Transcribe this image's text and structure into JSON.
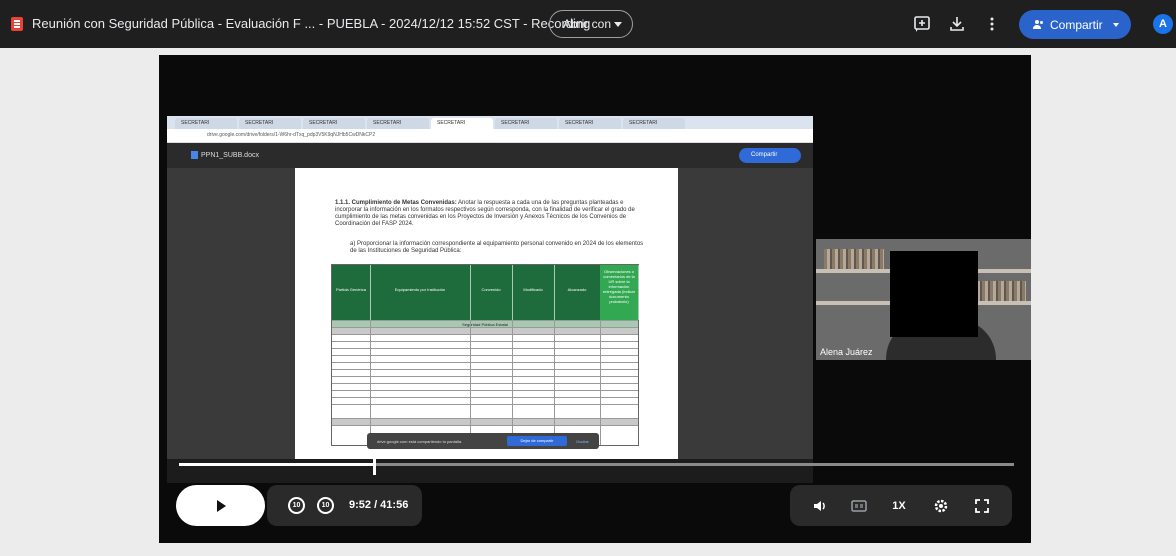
{
  "topbar": {
    "title": "Reunión con Seguridad Pública - Evaluación F ... - PUEBLA - 2024/12/12 15:52 CST - Recording",
    "open_with_label": "Abrir con",
    "share_label": "Compartir",
    "avatar_initial": "A",
    "icons": [
      "add-comment-icon",
      "download-icon",
      "more-vert-icon",
      "people-icon",
      "chevron-down-icon"
    ]
  },
  "video": {
    "screen": {
      "tabs": [
        "SECRETARI",
        "SECRETARI",
        "SECRETARI",
        "SECRETARI",
        "SECRETARI",
        "SECRETARI",
        "SECRETARI",
        "SECRETARI"
      ],
      "address": "drive.google.com/drive/folders/1-W6hr-dTxq_pdp3V5K9qNJHb5CwDNkCP2",
      "doc_name": "PPN1_SUBB.docx",
      "doc_share_label": "Compartir",
      "heading_bold": "1.1.1. Cumplimiento de Metas Convenidas:",
      "heading_text": " Anotar la respuesta a cada una de las preguntas planteadas e incorporar la información en los formatos respectivos según corresponda, con la finalidad de verificar el grado de cumplimiento de las metas convenidas en los Proyectos de Inversión y Anexos Técnicos de los Convenios de Coordinación del FASP 2024.",
      "item_text": "a) Proporcionar la información correspondiente al equipamiento personal convenido en 2024 de los elementos de las Instituciones de Seguridad Pública:",
      "table_headers": [
        "Partida Genérica",
        "Equipamiento por Institución",
        "Convenido",
        "Modificado",
        "Alcanzado",
        "Observaciones o comentarios de la UR sobre la información entregada (indicar documento probatorio)"
      ],
      "table_section": "Seguridad Pública Estatal",
      "toast_text": "drive.google.com está compartiendo tu pantalla.",
      "toast_stop": "Dejar de compartir",
      "toast_hide": "Ocultar"
    },
    "participant_name": "Alena Juárez",
    "progress_fraction": 0.234,
    "time_display": "9:52 / 41:56",
    "speed_label": "1X",
    "seek_back_label": "10",
    "seek_forward_label": "10",
    "controls": [
      "play-icon",
      "replay-10-icon",
      "forward-10-icon",
      "volume-icon",
      "captions-icon",
      "settings-icon",
      "fullscreen-icon"
    ]
  },
  "colors": {
    "topbar_bg": "#1f1f1f",
    "share_button": "#2a63c9",
    "avatar": "#1a73e8",
    "table_header_green": "#1e6b3c"
  }
}
